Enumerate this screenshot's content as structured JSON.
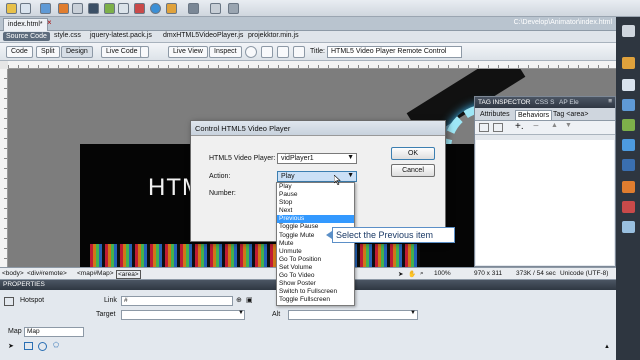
{
  "document": {
    "tab": "index.html*",
    "path": "C:\\Develop\\Animator\\index.html"
  },
  "related_files": [
    "Source Code",
    "style.css",
    "jquery-latest.pack.js",
    "dmxHTML5VideoPlayer.js",
    "projekktor.min.js"
  ],
  "view_bar": {
    "code": "Code",
    "split": "Split",
    "design": "Design",
    "live_code": "Live Code",
    "live_view": "Live View",
    "inspect": "Inspect",
    "title_label": "Title:",
    "title_value": "HTML5 Video Player Remote Control"
  },
  "canvas": {
    "html_text": "HTM"
  },
  "tag_inspector": {
    "title": "TAG INSPECTOR",
    "tabs_top": [
      "CSS S",
      "AP Ele"
    ],
    "tabs": [
      "Attributes",
      "Behaviors",
      "Tag <area>"
    ]
  },
  "dialog": {
    "title": "Control HTML5 Video Player",
    "player_label": "HTML5 Video Player:",
    "player_value": "vidPlayer1",
    "action_label": "Action:",
    "action_value": "Play",
    "number_label": "Number:",
    "ok": "OK",
    "cancel": "Cancel"
  },
  "dropdown_items": [
    "Play",
    "Pause",
    "Stop",
    "Next",
    "Previous",
    "Toggle Pause",
    "Toggle Mute",
    "Mute",
    "Unmute",
    "Go To Position",
    "Set Volume",
    "Go To Video",
    "Show Poster",
    "Switch to Fullscreen",
    "Toggle Fullscreen"
  ],
  "highlighted_item": "Previous",
  "callout": "Select the Previous item",
  "status_bar": {
    "tags": [
      "<body>",
      "<div#remote>",
      "<map#Map>",
      "<area>"
    ],
    "zoom": "100%",
    "size": "970 x 311",
    "weight": "373K / 54 sec",
    "encoding": "Unicode (UTF-8)"
  },
  "properties": {
    "title": "PROPERTIES",
    "hotspot": "Hotspot",
    "link_label": "Link",
    "link_value": "#",
    "target_label": "Target",
    "alt_label": "Alt",
    "map_label": "Map",
    "map_value": "Map"
  },
  "colors": {
    "highlight": "#3399ff",
    "callout_border": "#5b8fc7",
    "panel_title": "#2f3742"
  }
}
